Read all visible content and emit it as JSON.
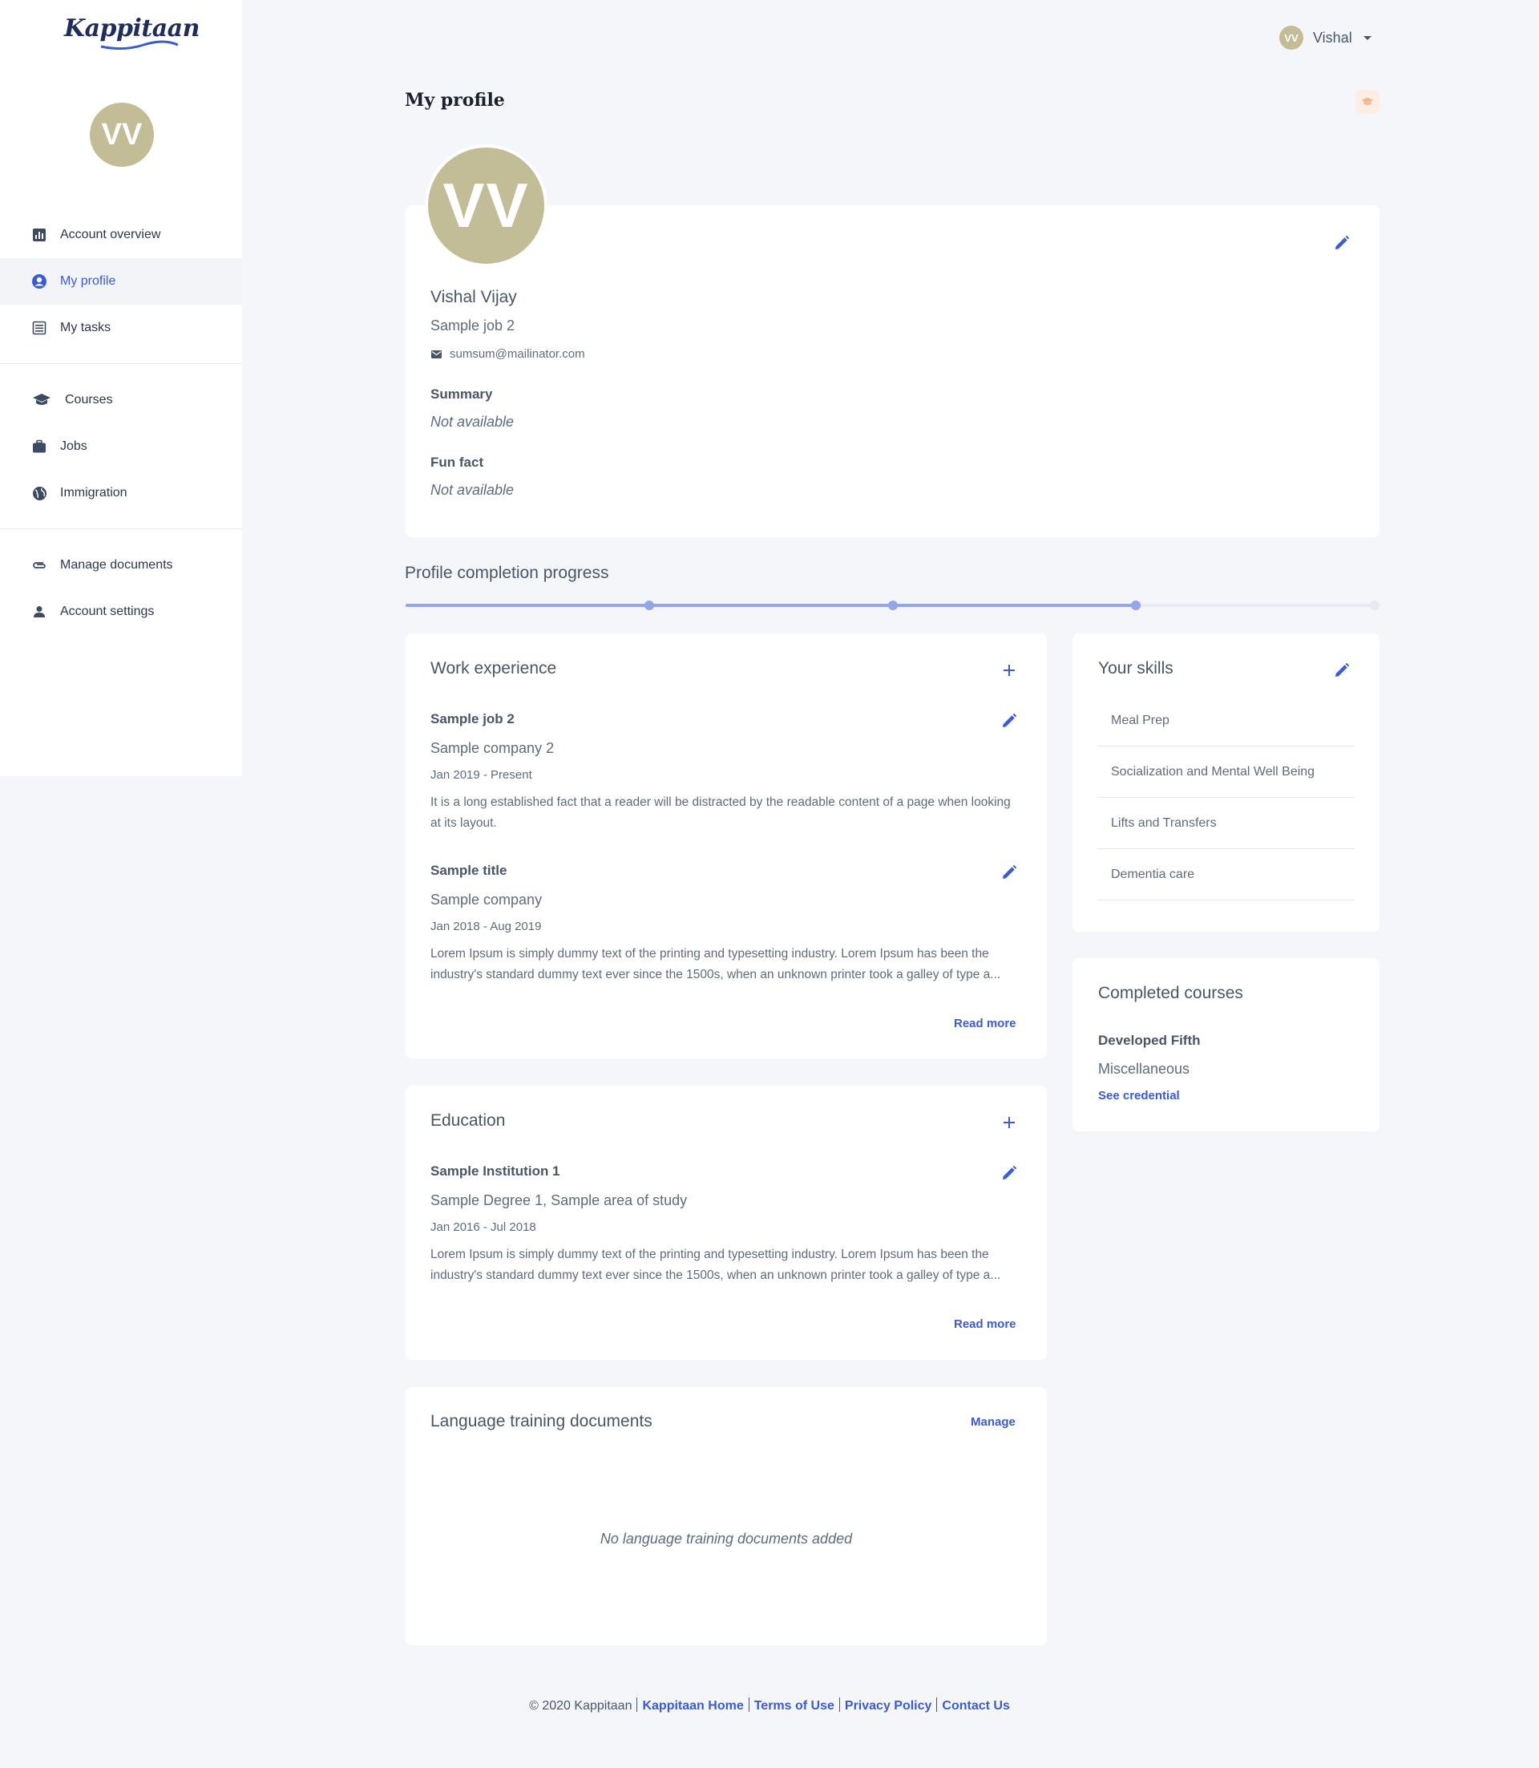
{
  "brand": {
    "name": "Kappitaan"
  },
  "user": {
    "initials": "VV",
    "display_name": "Vishal"
  },
  "sidebar": {
    "items": [
      {
        "label": "Account overview"
      },
      {
        "label": "My profile"
      },
      {
        "label": "My tasks"
      },
      {
        "label": "Courses"
      },
      {
        "label": "Jobs"
      },
      {
        "label": "Immigration"
      },
      {
        "label": "Manage documents"
      },
      {
        "label": "Account settings"
      }
    ]
  },
  "page": {
    "title": "My profile"
  },
  "profile": {
    "full_name": "Vishal Vijay",
    "job": "Sample job 2",
    "email": "sumsum@mailinator.com",
    "summary_label": "Summary",
    "summary_value": "Not available",
    "funfact_label": "Fun fact",
    "funfact_value": "Not available"
  },
  "progress": {
    "title": "Profile completion progress",
    "fraction": 0.75,
    "steps": 4,
    "completed_steps": 3
  },
  "work": {
    "title": "Work experience",
    "items": [
      {
        "title": "Sample job 2",
        "company": "Sample company 2",
        "dates": "Jan 2019 - Present",
        "description": "It is a long established fact that a reader will be distracted by the readable content of a page when looking at its layout."
      },
      {
        "title": "Sample title",
        "company": "Sample company",
        "dates": "Jan 2018 - Aug 2019",
        "description": "Lorem Ipsum is simply dummy text of the printing and typesetting industry. Lorem Ipsum has been the industry's standard dummy text ever since the 1500s, when an unknown printer took a galley of type a...",
        "read_more": "Read more"
      }
    ]
  },
  "education": {
    "title": "Education",
    "items": [
      {
        "institution": "Sample Institution 1",
        "degree": "Sample Degree 1, Sample area of study",
        "dates": "Jan 2016 - Jul 2018",
        "description": "Lorem Ipsum is simply dummy text of the printing and typesetting industry. Lorem Ipsum has been the industry's standard dummy text ever since the 1500s, when an unknown printer took a galley of type a...",
        "read_more": "Read more"
      }
    ]
  },
  "language_docs": {
    "title": "Language training documents",
    "manage": "Manage",
    "empty": "No language training documents added"
  },
  "skills": {
    "title": "Your skills",
    "items": [
      "Meal Prep",
      "Socialization and Mental Well Being",
      "Lifts and Transfers",
      "Dementia care"
    ]
  },
  "courses": {
    "title": "Completed courses",
    "items": [
      {
        "name": "Developed Fifth",
        "category": "Miscellaneous",
        "link": "See credential"
      }
    ]
  },
  "footer": {
    "copyright": "© 2020 Kappitaan",
    "links": [
      "Kappitaan Home",
      "Terms of Use",
      "Privacy Policy",
      "Contact Us"
    ]
  },
  "colors": {
    "accent": "#3b5bd1",
    "avatar": "#c2bc97",
    "progress": "#94a6ea"
  }
}
